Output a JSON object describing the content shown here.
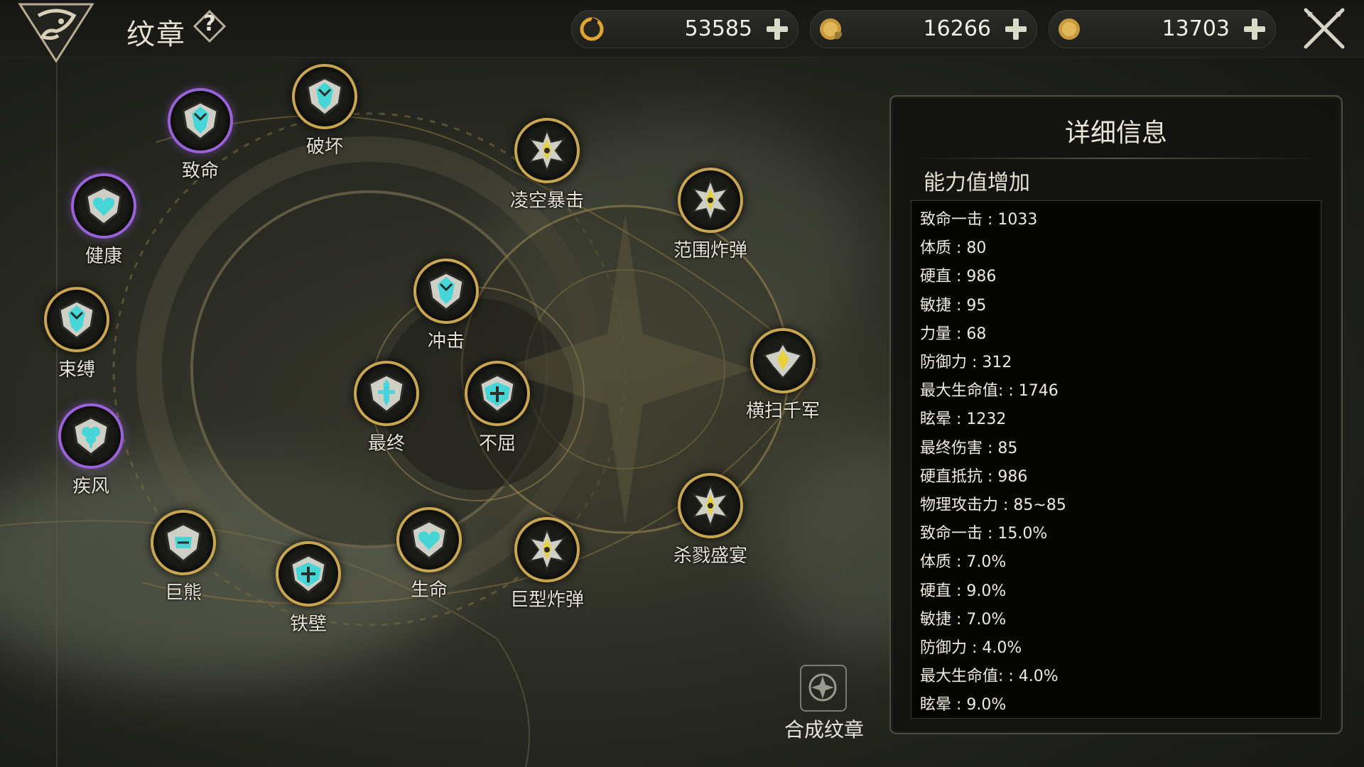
{
  "header": {
    "title": "纹章",
    "help_icon": "question-icon",
    "currencies": [
      {
        "name": "refresh-currency",
        "icon": "swirl-coin-icon",
        "value": "53585"
      },
      {
        "name": "gold-lock-currency",
        "icon": "gold-coin-lock-icon",
        "value": "16266"
      },
      {
        "name": "gold-currency",
        "icon": "gold-coin-icon",
        "value": "13703"
      }
    ],
    "close_icon": "crossed-swords-close-icon"
  },
  "emblems": [
    {
      "id": "pohuai",
      "label": "破坏",
      "rarity": "gold",
      "icon": "shield-blade-icon"
    },
    {
      "id": "zhiming",
      "label": "致命",
      "rarity": "purple",
      "icon": "shield-blade-icon"
    },
    {
      "id": "jiankang",
      "label": "健康",
      "rarity": "purple",
      "icon": "heart-shield-icon"
    },
    {
      "id": "shufu",
      "label": "束缚",
      "rarity": "gold",
      "icon": "shield-blade-icon"
    },
    {
      "id": "jifeng",
      "label": "疾风",
      "rarity": "purple",
      "icon": "clover-shield-icon"
    },
    {
      "id": "juxiong",
      "label": "巨熊",
      "rarity": "gold",
      "icon": "bear-shield-icon"
    },
    {
      "id": "tiebi",
      "label": "铁壁",
      "rarity": "gold",
      "icon": "cross-shield-icon"
    },
    {
      "id": "shengming",
      "label": "生命",
      "rarity": "gold",
      "icon": "heart-shield-icon"
    },
    {
      "id": "chongji",
      "label": "冲击",
      "rarity": "gold",
      "icon": "shield-blade-icon"
    },
    {
      "id": "zuizhong",
      "label": "最终",
      "rarity": "gold",
      "icon": "sword-shield-icon"
    },
    {
      "id": "buqu",
      "label": "不屈",
      "rarity": "gold",
      "icon": "cross-shield-icon"
    },
    {
      "id": "lingkong",
      "label": "凌空暴击",
      "rarity": "gold",
      "icon": "spiked-cross-icon"
    },
    {
      "id": "fanwei",
      "label": "范围炸弹",
      "rarity": "gold",
      "icon": "spiked-cross-icon"
    },
    {
      "id": "hengsao",
      "label": "横扫千军",
      "rarity": "gold",
      "icon": "winged-emblem-icon"
    },
    {
      "id": "shalu",
      "label": "杀戮盛宴",
      "rarity": "gold",
      "icon": "spiked-cross-icon"
    },
    {
      "id": "juxing",
      "label": "巨型炸弹",
      "rarity": "gold",
      "icon": "spiked-cross-icon"
    }
  ],
  "synthesize": {
    "label": "合成纹章",
    "icon": "star-wheel-icon"
  },
  "details": {
    "title": "详细信息",
    "subtitle": "能力值增加",
    "stats": [
      "致命一击 : 1033",
      "体质 : 80",
      "硬直 : 986",
      "敏捷 : 95",
      "力量 : 68",
      "防御力 : 312",
      "最大生命值: : 1746",
      "眩晕 : 1232",
      "最终伤害 : 85",
      "硬直抵抗 : 986",
      "物理攻击力 : 85~85",
      "致命一击 : 15.0%",
      "体质 : 7.0%",
      "硬直 : 9.0%",
      "敏捷 : 7.0%",
      "防御力 : 4.0%",
      "最大生命值: : 4.0%",
      "眩晕 : 9.0%"
    ]
  },
  "colors": {
    "gold_ring": "#c9a550",
    "purple_ring": "#9a62d8",
    "emblem_cyan": "#46d6d8",
    "emblem_yellow": "#e8d23a"
  }
}
